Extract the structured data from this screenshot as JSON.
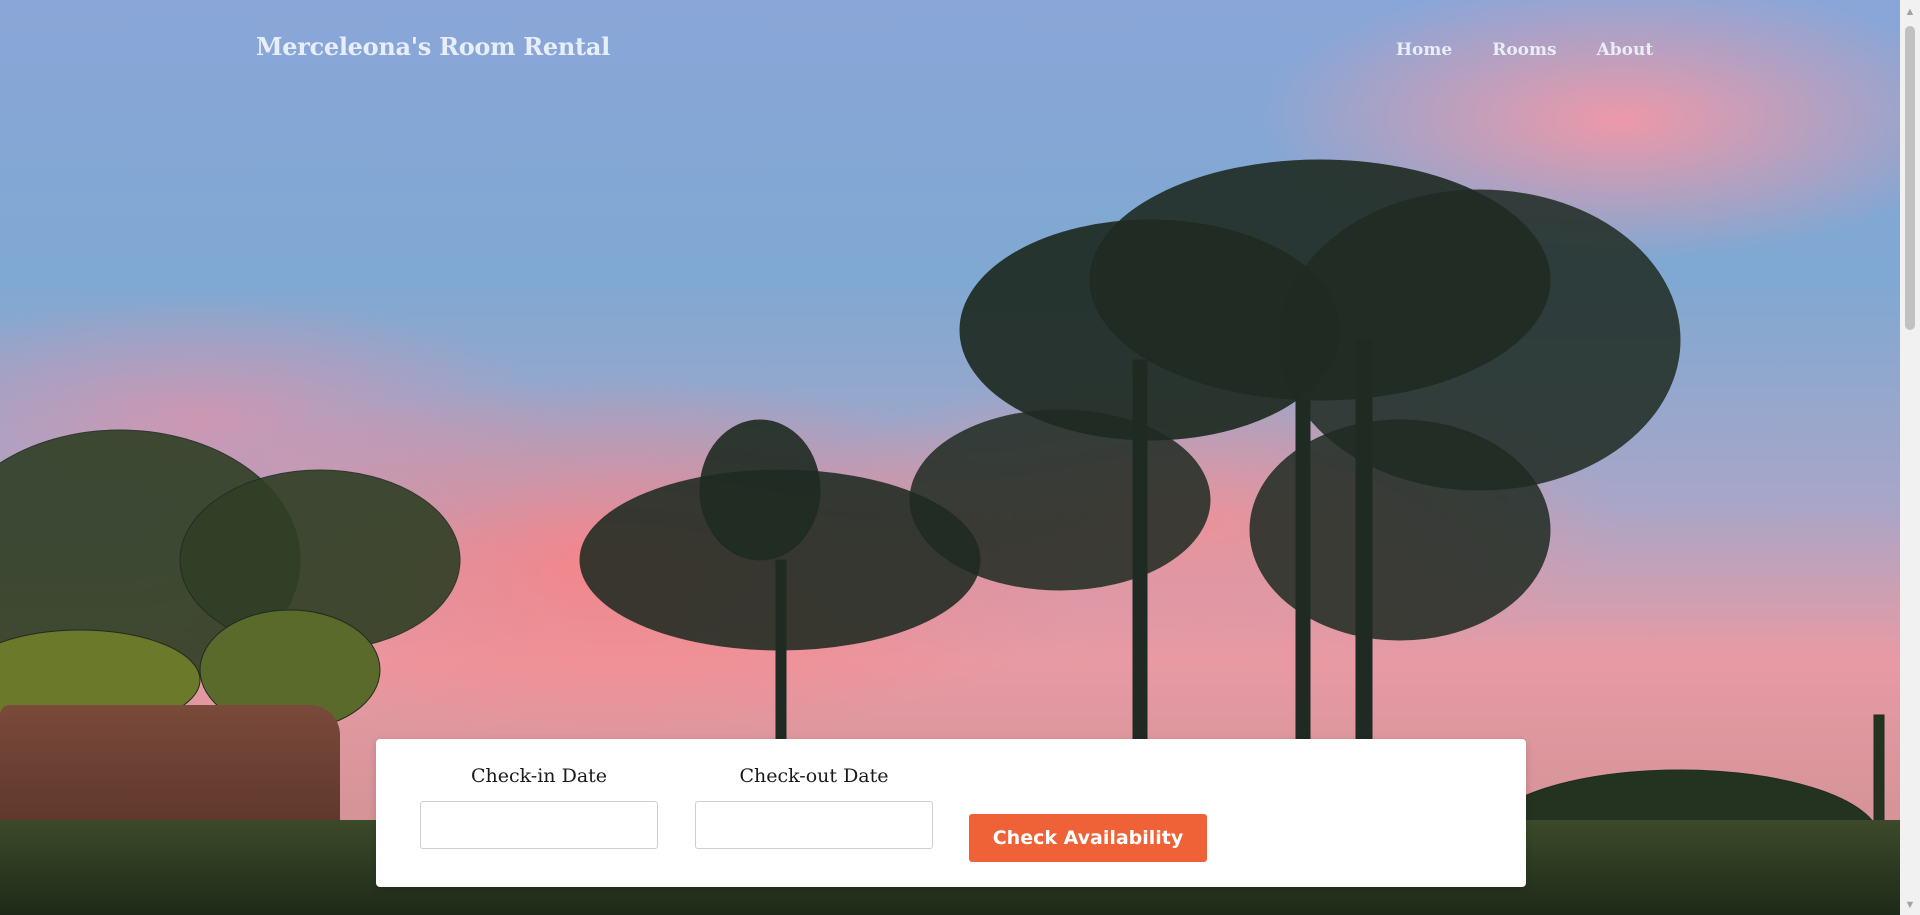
{
  "brand": {
    "title": "Merceleona's Room Rental"
  },
  "nav": {
    "items": [
      {
        "label": "Home"
      },
      {
        "label": "Rooms"
      },
      {
        "label": "About"
      }
    ]
  },
  "booking": {
    "checkin_label": "Check-in Date",
    "checkin_value": "",
    "checkout_label": "Check-out Date",
    "checkout_value": "",
    "submit_label": "Check Availability"
  },
  "colors": {
    "accent": "#ef6136",
    "card_bg": "#ffffff",
    "nav_text": "#e8eef8"
  },
  "icons": {
    "scroll_up": "chevron-up-icon",
    "scroll_down": "chevron-down-icon"
  }
}
